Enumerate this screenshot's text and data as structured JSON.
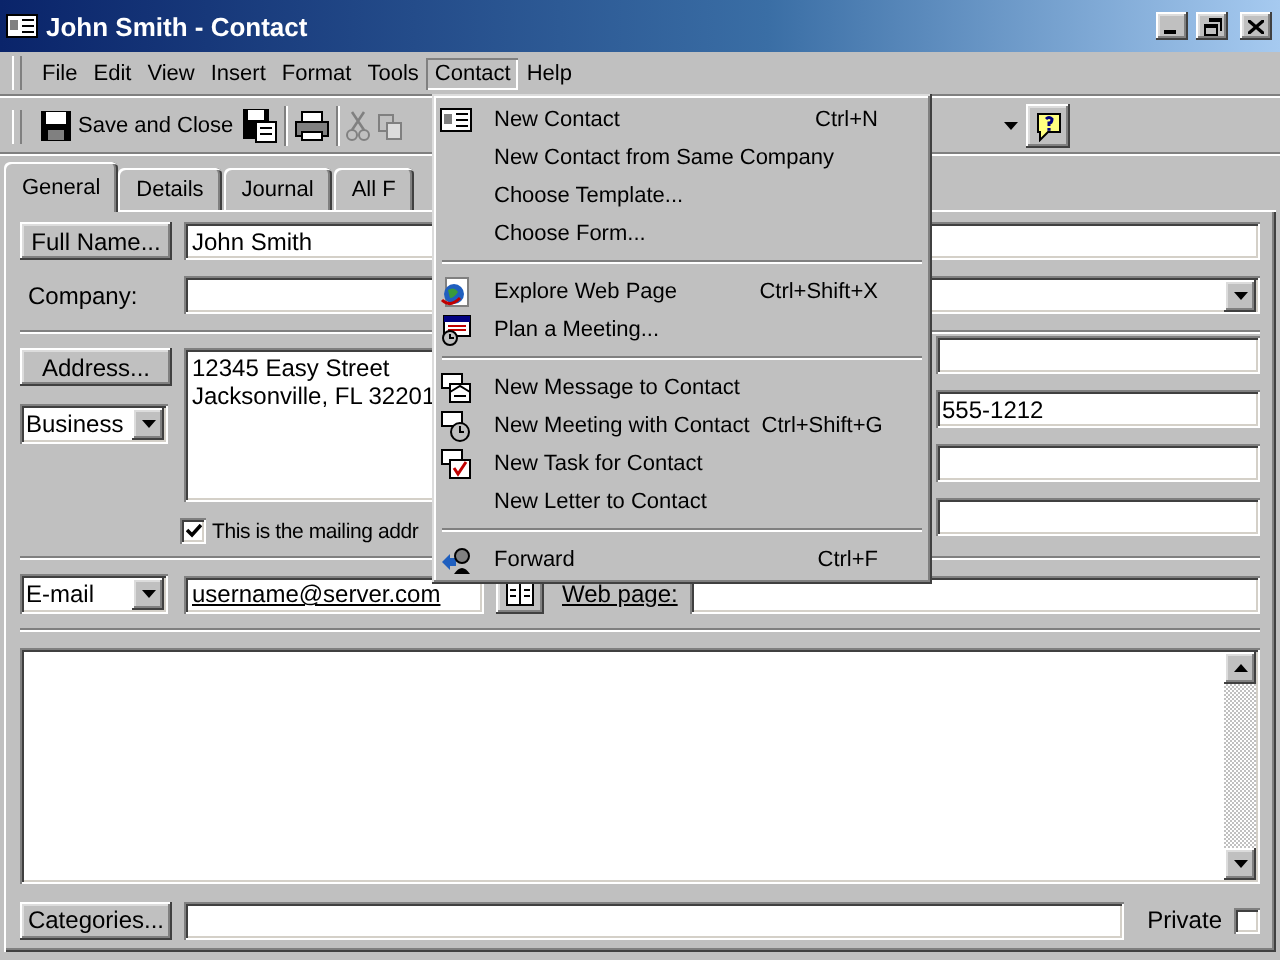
{
  "window": {
    "title": "John Smith - Contact"
  },
  "menu_bar": [
    {
      "label": "File",
      "selected": false
    },
    {
      "label": "Edit",
      "selected": false
    },
    {
      "label": "View",
      "selected": false
    },
    {
      "label": "Insert",
      "selected": false
    },
    {
      "label": "Format",
      "selected": false
    },
    {
      "label": "Tools",
      "selected": false
    },
    {
      "label": "Contact",
      "selected": true
    },
    {
      "label": "Help",
      "selected": false
    }
  ],
  "toolbar": {
    "save_close": "Save and Close"
  },
  "tabs": [
    {
      "label": "General",
      "selected": true
    },
    {
      "label": "Details",
      "selected": false
    },
    {
      "label": "Journal",
      "selected": false
    },
    {
      "label": "All F",
      "selected": false
    }
  ],
  "form": {
    "full_name_button": "Full Name...",
    "full_name": "John Smith",
    "company_label": "Company:",
    "address_button": "Address...",
    "address_type": "Business",
    "address_lines": [
      "12345 Easy Street",
      "Jacksonville, FL  32201"
    ],
    "phone": "555-1212",
    "mailing": {
      "label": "This is the mailing addr",
      "checked": true
    },
    "email_type": "E-mail",
    "email": "username@server.com",
    "web_page_label": "Web page:",
    "categories_button": "Categories...",
    "private": {
      "label": "Private",
      "checked": false
    }
  },
  "contact_menu": [
    {
      "kind": "card",
      "label": "New Contact",
      "shortcut": "Ctrl+N"
    },
    {
      "kind": "plain",
      "label": "New Contact from Same Company"
    },
    {
      "kind": "plain",
      "label": "Choose Template..."
    },
    {
      "kind": "plain",
      "label": "Choose Form..."
    },
    {
      "kind": "separator"
    },
    {
      "kind": "globe",
      "label": "Explore Web Page",
      "shortcut": "Ctrl+Shift+X"
    },
    {
      "kind": "calendar",
      "label": "Plan a Meeting..."
    },
    {
      "kind": "separator"
    },
    {
      "kind": "message",
      "label": "New Message to Contact"
    },
    {
      "kind": "meeting",
      "label": "New Meeting with Contact",
      "shortcut": "Ctrl+Shift+G"
    },
    {
      "kind": "task",
      "label": "New Task for Contact"
    },
    {
      "kind": "plain",
      "label": "New Letter to Contact"
    },
    {
      "kind": "separator"
    },
    {
      "kind": "forward",
      "label": "Forward",
      "shortcut": "Ctrl+F"
    }
  ]
}
